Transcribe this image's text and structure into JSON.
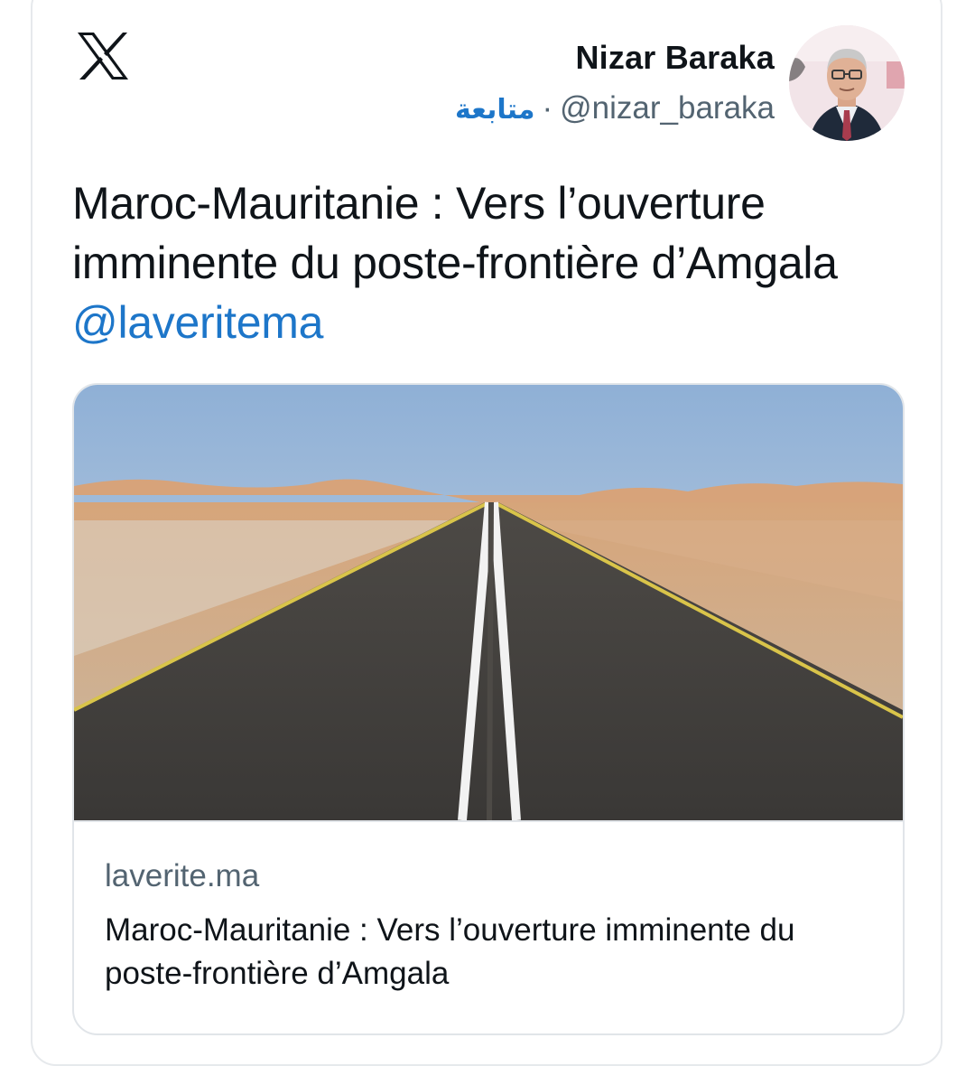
{
  "brand": {
    "logo_icon": "x-logo-icon"
  },
  "author": {
    "name": "Nizar Baraka",
    "handle": "@nizar_baraka",
    "separator": "·",
    "follow_label": "متابعة",
    "avatar_icon": "avatar-photo"
  },
  "tweet": {
    "text": "Maroc-Mauritanie : Vers l’ouverture imminente du poste-frontière d’Amgala ",
    "mention": "@laveritema"
  },
  "link_card": {
    "image_icon": "desert-road-photo",
    "domain": "laverite.ma",
    "title": "Maroc-Mauritanie : Vers l’ouverture imminente du poste-frontière d’Amgala"
  },
  "colors": {
    "link": "#1d76c9",
    "text": "#0f1419",
    "secondary": "#536471",
    "border": "#e1e5e9"
  }
}
